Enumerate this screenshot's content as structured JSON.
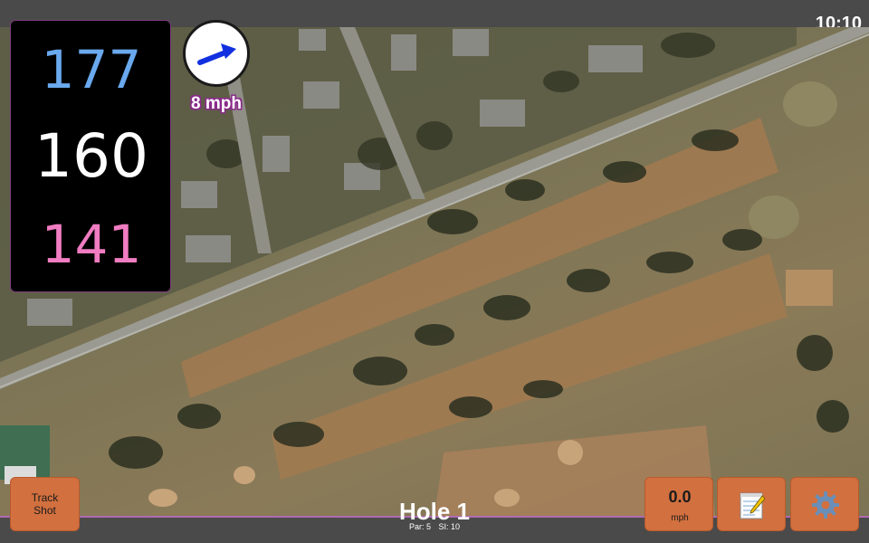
{
  "status": {
    "time": "10:10"
  },
  "distances": {
    "back": "177",
    "middle": "160",
    "front": "141"
  },
  "wind": {
    "speed_label": "8 mph",
    "direction": "arrow pointing upper-right"
  },
  "hole": {
    "title": "Hole 1",
    "par": "Par: 5",
    "stroke_index": "SI: 10"
  },
  "buttons": {
    "track_shot_line1": "Track",
    "track_shot_line2": "Shot",
    "wind_value": "0.0",
    "wind_unit": "mph",
    "notes_icon": "notepad-icon",
    "settings_icon": "gear-icon"
  },
  "map": {
    "type": "satellite aerial view of golf course",
    "icon": "satellite-map"
  },
  "colors": {
    "back_distance": "#6aa9ee",
    "middle_distance": "#ffffff",
    "front_distance": "#f07cc1",
    "button": "#d2703f",
    "accent": "#b06ab0"
  }
}
